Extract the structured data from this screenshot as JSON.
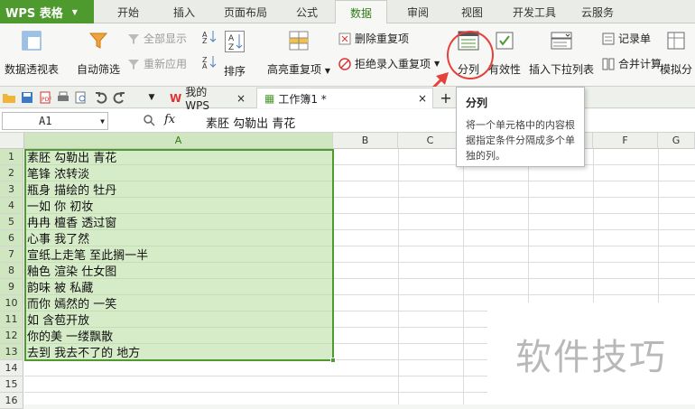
{
  "app": {
    "name": "WPS 表格"
  },
  "ribbon_tabs": [
    "开始",
    "插入",
    "页面布局",
    "公式",
    "数据",
    "审阅",
    "视图",
    "开发工具",
    "云服务"
  ],
  "active_tab": "数据",
  "ribbon": {
    "pivot": "数据透视表",
    "autofilter": "自动筛选",
    "show_all": "全部显示",
    "reapply": "重新应用",
    "sort": "排序",
    "highlight_dup": "高亮重复项",
    "delete_dup": "删除重复项",
    "reject_dup": "拒绝录入重复项",
    "split": "分列",
    "validity": "有效性",
    "dropdown": "插入下拉列表",
    "record": "记录单",
    "merge_calc": "合并计算",
    "simulate": "模拟分"
  },
  "doc_tabs": {
    "home": "我的WPS",
    "workbook": "工作簿1 *"
  },
  "formula_bar": {
    "cell_ref": "A1",
    "fx": "fx",
    "content": "素胚 勾勒出 青花"
  },
  "columns": [
    "A",
    "B",
    "C",
    "D",
    "E",
    "F",
    "G"
  ],
  "rows": [
    "素胚 勾勒出 青花",
    "笔锋 浓转淡",
    "瓶身 描绘的 牡丹",
    "一如 你 初妆",
    "冉冉 檀香 透过窗",
    "心事 我了然",
    "宣纸上走笔 至此搁一半",
    "釉色 渲染 仕女图",
    "韵味 被 私藏",
    "而你 嫣然的 一笑",
    "如 含苞开放",
    "你的美 一缕飘散",
    "去到 我去不了的 地方"
  ],
  "row_numbers": [
    "1",
    "2",
    "3",
    "4",
    "5",
    "6",
    "7",
    "8",
    "9",
    "10",
    "11",
    "12",
    "13",
    "14",
    "15",
    "16"
  ],
  "tooltip": {
    "title": "分列",
    "body": "将一个单元格中的内容根据指定条件分隔成多个单独的列。"
  },
  "watermark": "软件技巧",
  "colors": {
    "accent": "#4e9a2e",
    "selection": "#d6ecc8",
    "annotation": "#e5403a"
  }
}
